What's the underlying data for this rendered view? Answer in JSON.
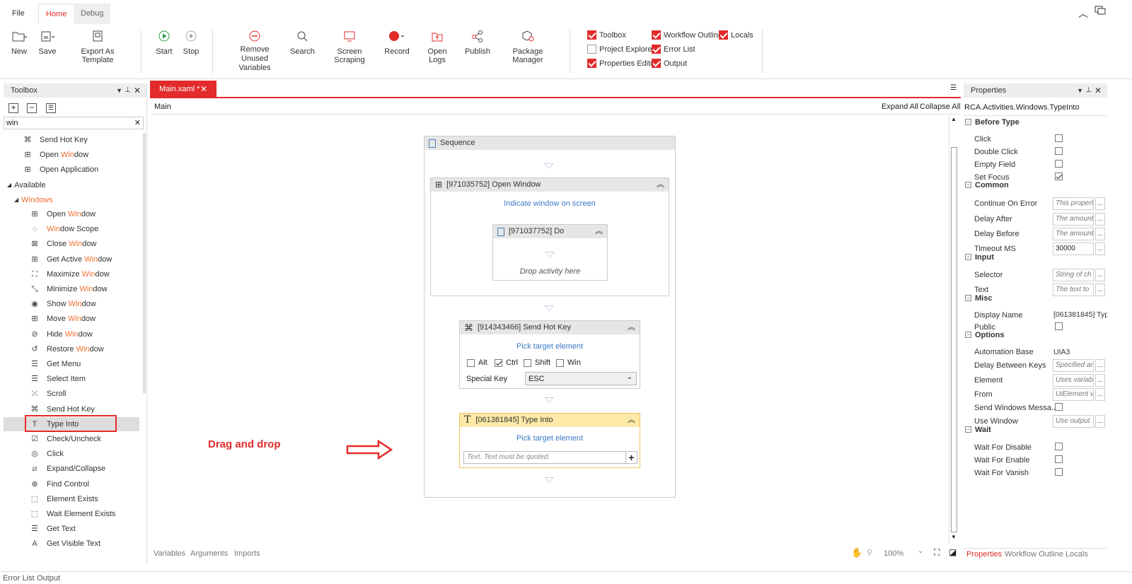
{
  "tabs": {
    "file": "File",
    "home": "Home",
    "debug": "Debug"
  },
  "ribbon": {
    "new": "New",
    "save": "Save",
    "export": "Export As Template",
    "start": "Start",
    "stop": "Stop",
    "remove_unused_1": "Remove Unused",
    "remove_unused_2": "Variables",
    "search": "Search",
    "screen_scraping": "Screen Scraping",
    "record": "Record",
    "open_logs": "Open Logs",
    "publish": "Publish",
    "package_manager": "Package Manager",
    "toggles": [
      {
        "label": "Toolbox",
        "checked": true
      },
      {
        "label": "Workflow Outline",
        "checked": true
      },
      {
        "label": "Locals",
        "checked": true
      },
      {
        "label": "Project Explorer",
        "checked": false
      },
      {
        "label": "Error List",
        "checked": true
      },
      {
        "label": "Properties Editor",
        "checked": true
      },
      {
        "label": "Output",
        "checked": true
      }
    ]
  },
  "toolbox": {
    "title": "Toolbox",
    "search_value": "win",
    "recent": [
      {
        "pre": "Send Hot Key",
        "hl": "",
        "post": ""
      },
      {
        "pre": "Open ",
        "hl": "Win",
        "post": "dow"
      },
      {
        "pre": "Open Application",
        "hl": "",
        "post": ""
      }
    ],
    "available": "Available",
    "windows_pre": "",
    "windows_hl": "Win",
    "windows_post": "dows",
    "items": [
      {
        "pre": "Open ",
        "hl": "Win",
        "post": "dow",
        "icon": "windows-icon",
        "glyph": "⊞"
      },
      {
        "pre": "",
        "hl": "Win",
        "post": "dow Scope",
        "icon": "scope-icon",
        "glyph": "◌"
      },
      {
        "pre": "Close ",
        "hl": "Win",
        "post": "dow",
        "icon": "close-window-icon",
        "glyph": "⊠"
      },
      {
        "pre": "Get Active ",
        "hl": "Win",
        "post": "dow",
        "icon": "active-window-icon",
        "glyph": "⊞"
      },
      {
        "pre": "Maximize ",
        "hl": "Win",
        "post": "dow",
        "icon": "maximize-icon",
        "glyph": "⛶"
      },
      {
        "pre": "Minimize ",
        "hl": "Win",
        "post": "dow",
        "icon": "minimize-icon",
        "glyph": "⤡"
      },
      {
        "pre": "Show ",
        "hl": "Win",
        "post": "dow",
        "icon": "eye-icon",
        "glyph": "◉"
      },
      {
        "pre": "Move ",
        "hl": "Win",
        "post": "dow",
        "icon": "move-icon",
        "glyph": "⊞"
      },
      {
        "pre": "Hide ",
        "hl": "Win",
        "post": "dow",
        "icon": "eye-off-icon",
        "glyph": "⊘"
      },
      {
        "pre": "Restore ",
        "hl": "Win",
        "post": "dow",
        "icon": "restore-icon",
        "glyph": "↺"
      },
      {
        "pre": "Get Menu",
        "hl": "",
        "post": "",
        "icon": "menu-icon",
        "glyph": "☰"
      },
      {
        "pre": "Select Item",
        "hl": "",
        "post": "",
        "icon": "select-icon",
        "glyph": "☰"
      },
      {
        "pre": "Scroll",
        "hl": "",
        "post": "",
        "icon": "scroll-icon",
        "glyph": "⤫"
      },
      {
        "pre": "Send Hot Key",
        "hl": "",
        "post": "",
        "icon": "hotkey-icon",
        "glyph": "⌘"
      },
      {
        "pre": "Type Into",
        "hl": "",
        "post": "",
        "icon": "type-icon",
        "glyph": "T"
      },
      {
        "pre": "Check/Uncheck",
        "hl": "",
        "post": "",
        "icon": "checkbox-icon",
        "glyph": "☑"
      },
      {
        "pre": "Click",
        "hl": "",
        "post": "",
        "icon": "click-icon",
        "glyph": "◎"
      },
      {
        "pre": "Expand/Collapse",
        "hl": "",
        "post": "",
        "icon": "expand-icon",
        "glyph": "⧄"
      },
      {
        "pre": "Find Control",
        "hl": "",
        "post": "",
        "icon": "find-icon",
        "glyph": "⊕"
      },
      {
        "pre": "Element Exists",
        "hl": "",
        "post": "",
        "icon": "element-icon",
        "glyph": "⬚"
      },
      {
        "pre": "Wait Element Exists",
        "hl": "",
        "post": "",
        "icon": "wait-icon",
        "glyph": "⬚"
      },
      {
        "pre": "Get Text",
        "hl": "",
        "post": "",
        "icon": "text-icon",
        "glyph": "☰"
      },
      {
        "pre": "Get Visible Text",
        "hl": "",
        "post": "",
        "icon": "visible-text-icon",
        "glyph": "A"
      }
    ]
  },
  "doc": {
    "tab": "Main.xaml *",
    "breadcrumb": "Main",
    "expand_all": "Expand All",
    "collapse_all": "Collapse All"
  },
  "workflow": {
    "sequence": "Sequence",
    "open_window": "[971035752] Open Window",
    "indicate": "Indicate window on screen",
    "do": "[971037752] Do",
    "drop": "Drop activity here",
    "send_hot_key": "[914343466] Send Hot Key",
    "pick1": "Pick target element",
    "mods": [
      {
        "label": "Alt",
        "checked": false
      },
      {
        "label": "Ctrl",
        "checked": true
      },
      {
        "label": "Shift",
        "checked": false
      },
      {
        "label": "Win",
        "checked": false
      }
    ],
    "special_key_label": "Special Key",
    "special_key_value": "ESC",
    "type_into": "[061381845] Type Into",
    "pick2": "Pick target element",
    "text_placeholder": "Text. Text must be quoted.",
    "drag_label": "Drag and drop"
  },
  "bottom": {
    "variables": "Variables",
    "arguments": "Arguments",
    "imports": "Imports",
    "zoom": "100%",
    "error_list": "Error List",
    "output": "Output"
  },
  "props": {
    "title": "Properties",
    "type": "RCA.Activities.Windows.TypeInto",
    "before_type": "Before Type",
    "click": "Click",
    "double_click": "Double Click",
    "empty_field": "Empty Field",
    "set_focus": "Set Focus",
    "common": "Common",
    "continue_on_error": "Continue On Error",
    "continue_on_error_v": "This property",
    "delay_after": "Delay After",
    "delay_after_v": "The amount",
    "delay_before": "Delay Before",
    "delay_before_v": "The amount",
    "timeout": "Timeout MS",
    "timeout_v": "30000",
    "input": "Input",
    "selector": "Selector",
    "selector_v": "String of ch",
    "text": "Text",
    "text_v": "The text to",
    "misc": "Misc",
    "display_name": "Display Name",
    "display_name_v": "[061381845] Typ",
    "public": "Public",
    "options": "Options",
    "automation_base": "Automation Base",
    "automation_base_v": "UIA3",
    "delay_between_keys": "Delay Between Keys",
    "delay_between_keys_v": "Specified ar",
    "element": "Element",
    "element_v": "Uses variab",
    "from": "From",
    "from_v": "UiElement v",
    "send_windows_messages": "Send Windows Messa...",
    "use_window": "Use Window",
    "use_window_v": "Use output",
    "wait": "Wait",
    "wait_disable": "Wait For Disable",
    "wait_enable": "Wait For Enable",
    "wait_vanish": "Wait For Vanish",
    "tab_properties": "Properties",
    "tab_outline": "Workflow Outline",
    "tab_locals": "Locals"
  },
  "colors": {
    "accent": "#e32b2b",
    "link": "#3a7ac8",
    "highlight": "#f07030",
    "type_into_bg": "#fde9a8"
  }
}
